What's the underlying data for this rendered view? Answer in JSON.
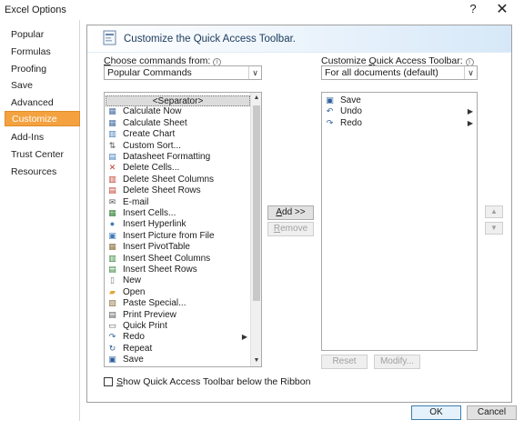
{
  "window": {
    "title": "Excel Options",
    "help": "?",
    "close": "✕"
  },
  "nav": {
    "items": [
      {
        "label": "Popular",
        "active": false
      },
      {
        "label": "Formulas",
        "active": false
      },
      {
        "label": "Proofing",
        "active": false
      },
      {
        "label": "Save",
        "active": false
      },
      {
        "label": "Advanced",
        "active": false
      },
      {
        "label": "Customize",
        "active": true
      },
      {
        "label": "Add-Ins",
        "active": false
      },
      {
        "label": "Trust Center",
        "active": false
      },
      {
        "label": "Resources",
        "active": false
      }
    ]
  },
  "banner": {
    "title": "Customize the Quick Access Toolbar."
  },
  "left": {
    "label_pre": "",
    "label_u": "C",
    "label_post": "hoose commands from:",
    "combo_value": "Popular Commands",
    "commands": [
      {
        "label": "<Separator>",
        "icon": "",
        "selected": true,
        "submenu": false
      },
      {
        "label": "Calculate Now",
        "icon": "calculator-icon",
        "selected": false,
        "submenu": false
      },
      {
        "label": "Calculate Sheet",
        "icon": "calculate-sheet-icon",
        "selected": false,
        "submenu": false
      },
      {
        "label": "Create Chart",
        "icon": "chart-icon",
        "selected": false,
        "submenu": false
      },
      {
        "label": "Custom Sort...",
        "icon": "sort-icon",
        "selected": false,
        "submenu": false
      },
      {
        "label": "Datasheet Formatting",
        "icon": "datasheet-icon",
        "selected": false,
        "submenu": false
      },
      {
        "label": "Delete Cells...",
        "icon": "delete-cells-icon",
        "selected": false,
        "submenu": false
      },
      {
        "label": "Delete Sheet Columns",
        "icon": "delete-columns-icon",
        "selected": false,
        "submenu": false
      },
      {
        "label": "Delete Sheet Rows",
        "icon": "delete-rows-icon",
        "selected": false,
        "submenu": false
      },
      {
        "label": "E-mail",
        "icon": "email-icon",
        "selected": false,
        "submenu": false
      },
      {
        "label": "Insert Cells...",
        "icon": "insert-cells-icon",
        "selected": false,
        "submenu": false
      },
      {
        "label": "Insert Hyperlink",
        "icon": "hyperlink-icon",
        "selected": false,
        "submenu": false
      },
      {
        "label": "Insert Picture from File",
        "icon": "picture-icon",
        "selected": false,
        "submenu": false
      },
      {
        "label": "Insert PivotTable",
        "icon": "pivot-icon",
        "selected": false,
        "submenu": false
      },
      {
        "label": "Insert Sheet Columns",
        "icon": "insert-columns-icon",
        "selected": false,
        "submenu": false
      },
      {
        "label": "Insert Sheet Rows",
        "icon": "insert-rows-icon",
        "selected": false,
        "submenu": false
      },
      {
        "label": "New",
        "icon": "new-document-icon",
        "selected": false,
        "submenu": false
      },
      {
        "label": "Open",
        "icon": "open-folder-icon",
        "selected": false,
        "submenu": false
      },
      {
        "label": "Paste Special...",
        "icon": "paste-icon",
        "selected": false,
        "submenu": false
      },
      {
        "label": "Print Preview",
        "icon": "print-preview-icon",
        "selected": false,
        "submenu": false
      },
      {
        "label": "Quick Print",
        "icon": "printer-icon",
        "selected": false,
        "submenu": false
      },
      {
        "label": "Redo",
        "icon": "redo-icon",
        "selected": false,
        "submenu": true
      },
      {
        "label": "Repeat",
        "icon": "repeat-icon",
        "selected": false,
        "submenu": false
      },
      {
        "label": "Save",
        "icon": "save-icon",
        "selected": false,
        "submenu": false
      }
    ],
    "checkbox_pre": "",
    "checkbox_u": "S",
    "checkbox_post": "how Quick Access Toolbar below the Ribbon"
  },
  "middle": {
    "add_u": "A",
    "add_post": "dd >>",
    "remove_u": "R",
    "remove_post": "emove"
  },
  "right": {
    "label_pre": "Customize ",
    "label_u": "Q",
    "label_post": "uick Access Toolbar:",
    "combo_value": "For all documents (default)",
    "commands": [
      {
        "label": "Save",
        "icon": "save-icon",
        "submenu": false
      },
      {
        "label": "Undo",
        "icon": "undo-icon",
        "submenu": true
      },
      {
        "label": "Redo",
        "icon": "redo-icon",
        "submenu": true
      }
    ],
    "reset": "Reset",
    "modify": "Modify...",
    "move_up": "▲",
    "move_down": "▼"
  },
  "footer": {
    "ok": "OK",
    "cancel": "Cancel"
  },
  "glyphs": {
    "combo_arrow": "∨",
    "scroll_up": "▲",
    "scroll_down": "▼",
    "submenu_arrow": "▶"
  }
}
